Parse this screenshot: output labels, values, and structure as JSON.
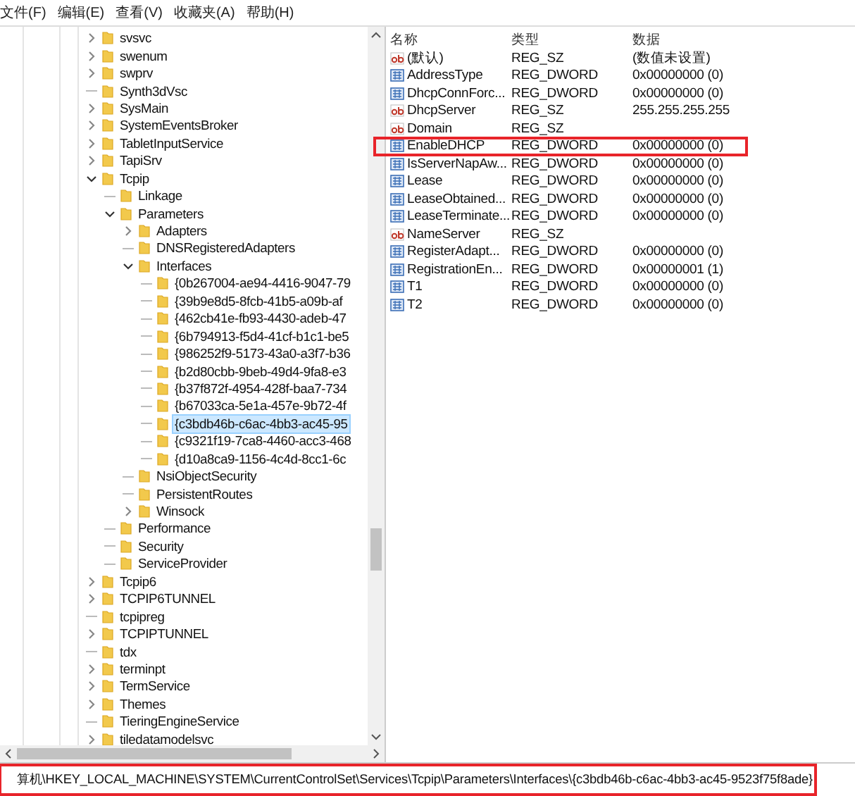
{
  "menu": [
    "文件(F)",
    "编辑(E)",
    "查看(V)",
    "收藏夹(A)",
    "帮助(H)"
  ],
  "tree": [
    {
      "label": "svsvc",
      "expanded": false,
      "selected": false
    },
    {
      "label": "swenum",
      "expanded": false,
      "selected": false
    },
    {
      "label": "swprv",
      "expanded": false,
      "selected": false
    },
    {
      "label": "Synth3dVsc",
      "selected": false
    },
    {
      "label": "SysMain",
      "expanded": false,
      "selected": false
    },
    {
      "label": "SystemEventsBroker",
      "expanded": false,
      "selected": false
    },
    {
      "label": "TabletInputService",
      "expanded": false,
      "selected": false
    },
    {
      "label": "TapiSrv",
      "expanded": false,
      "selected": false
    },
    {
      "label": "Tcpip",
      "expanded": true,
      "selected": false,
      "children": [
        {
          "label": "Linkage",
          "selected": false
        },
        {
          "label": "Parameters",
          "expanded": true,
          "selected": false,
          "children": [
            {
              "label": "Adapters",
              "expanded": false,
              "selected": false
            },
            {
              "label": "DNSRegisteredAdapters",
              "selected": false
            },
            {
              "label": "Interfaces",
              "expanded": true,
              "selected": false,
              "children": [
                {
                  "label": "{0b267004-ae94-4416-9047-79",
                  "selected": false
                },
                {
                  "label": "{39b9e8d5-8fcb-41b5-a09b-af",
                  "selected": false
                },
                {
                  "label": "{462cb41e-fb93-4430-adeb-47",
                  "selected": false
                },
                {
                  "label": "{6b794913-f5d4-41cf-b1c1-be5",
                  "selected": false
                },
                {
                  "label": "{986252f9-5173-43a0-a3f7-b36",
                  "selected": false
                },
                {
                  "label": "{b2d80cbb-9beb-49d4-9fa8-e3",
                  "selected": false
                },
                {
                  "label": "{b37f872f-4954-428f-baa7-734",
                  "selected": false
                },
                {
                  "label": "{b67033ca-5e1a-457e-9b72-4f",
                  "selected": false
                },
                {
                  "label": "{c3bdb46b-c6ac-4bb3-ac45-95",
                  "selected": true
                },
                {
                  "label": "{c9321f19-7ca8-4460-acc3-468",
                  "selected": false
                },
                {
                  "label": "{d10a8ca9-1156-4c4d-8cc1-6c",
                  "selected": false
                }
              ]
            },
            {
              "label": "NsiObjectSecurity",
              "selected": false
            },
            {
              "label": "PersistentRoutes",
              "selected": false
            },
            {
              "label": "Winsock",
              "expanded": false,
              "selected": false
            }
          ]
        },
        {
          "label": "Performance",
          "selected": false
        },
        {
          "label": "Security",
          "selected": false
        },
        {
          "label": "ServiceProvider",
          "selected": false
        }
      ]
    },
    {
      "label": "Tcpip6",
      "expanded": false,
      "selected": false
    },
    {
      "label": "TCPIP6TUNNEL",
      "expanded": false,
      "selected": false
    },
    {
      "label": "tcpipreg",
      "selected": false
    },
    {
      "label": "TCPIPTUNNEL",
      "expanded": false,
      "selected": false
    },
    {
      "label": "tdx",
      "selected": false
    },
    {
      "label": "terminpt",
      "expanded": false,
      "selected": false
    },
    {
      "label": "TermService",
      "expanded": false,
      "selected": false
    },
    {
      "label": "Themes",
      "expanded": false,
      "selected": false
    },
    {
      "label": "TieringEngineService",
      "selected": false
    },
    {
      "label": "tiledatamodelsvc",
      "expanded": false,
      "selected": false
    }
  ],
  "values": {
    "columns": [
      "名称",
      "类型",
      "数据"
    ],
    "rows": [
      {
        "kind": "string",
        "name": "(默认)",
        "type": "REG_SZ",
        "data": "(数值未设置)",
        "highlighted": false
      },
      {
        "kind": "number",
        "name": "AddressType",
        "type": "REG_DWORD",
        "data": "0x00000000 (0)",
        "highlighted": false
      },
      {
        "kind": "number",
        "name": "DhcpConnForc...",
        "type": "REG_DWORD",
        "data": "0x00000000 (0)",
        "highlighted": false
      },
      {
        "kind": "string",
        "name": "DhcpServer",
        "type": "REG_SZ",
        "data": "255.255.255.255",
        "highlighted": false
      },
      {
        "kind": "string",
        "name": "Domain",
        "type": "REG_SZ",
        "highlighted": false
      },
      {
        "kind": "number",
        "name": "EnableDHCP",
        "type": "REG_DWORD",
        "data": "0x00000000 (0)",
        "highlighted": true
      },
      {
        "kind": "number",
        "name": "IsServerNapAw...",
        "type": "REG_DWORD",
        "data": "0x00000000 (0)",
        "highlighted": false
      },
      {
        "kind": "number",
        "name": "Lease",
        "type": "REG_DWORD",
        "data": "0x00000000 (0)",
        "highlighted": false
      },
      {
        "kind": "number",
        "name": "LeaseObtained...",
        "type": "REG_DWORD",
        "data": "0x00000000 (0)",
        "highlighted": false
      },
      {
        "kind": "number",
        "name": "LeaseTerminate...",
        "type": "REG_DWORD",
        "data": "0x00000000 (0)",
        "highlighted": false
      },
      {
        "kind": "string",
        "name": "NameServer",
        "type": "REG_SZ",
        "highlighted": false
      },
      {
        "kind": "number",
        "name": "RegisterAdapt...",
        "type": "REG_DWORD",
        "data": "0x00000000 (0)",
        "highlighted": false
      },
      {
        "kind": "number",
        "name": "RegistrationEn...",
        "type": "REG_DWORD",
        "data": "0x00000001 (1)",
        "highlighted": false
      },
      {
        "kind": "number",
        "name": "T1",
        "type": "REG_DWORD",
        "data": "0x00000000 (0)",
        "highlighted": false
      },
      {
        "kind": "number",
        "name": "T2",
        "type": "REG_DWORD",
        "data": "0x00000000 (0)",
        "highlighted": false
      }
    ]
  },
  "status_bar": {
    "path": "算机\\HKEY_LOCAL_MACHINE\\SYSTEM\\CurrentControlSet\\Services\\Tcpip\\Parameters\\Interfaces\\{c3bdb46b-c6ac-4bb3-ac45-9523f75f8ade}",
    "highlighted": true
  }
}
